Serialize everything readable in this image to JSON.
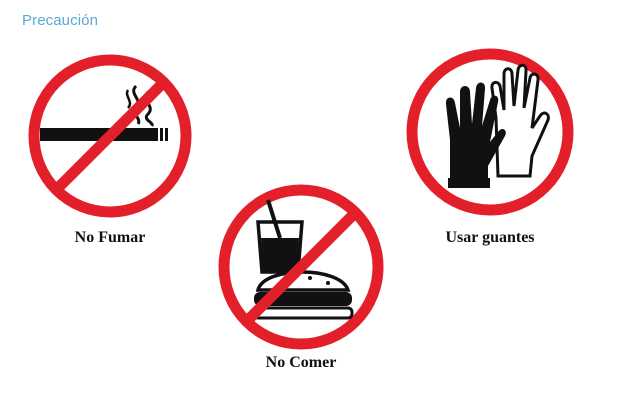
{
  "header": {
    "title": "Precaución"
  },
  "signs": [
    {
      "label": "No Fumar",
      "icon": "no-smoking-icon"
    },
    {
      "label": "No Comer",
      "icon": "no-eating-icon"
    },
    {
      "label": "Usar guantes",
      "icon": "gloves-icon"
    }
  ],
  "colors": {
    "prohibition_red": "#e3202a",
    "symbol_black": "#111111",
    "header_blue": "#5aa9d0"
  }
}
